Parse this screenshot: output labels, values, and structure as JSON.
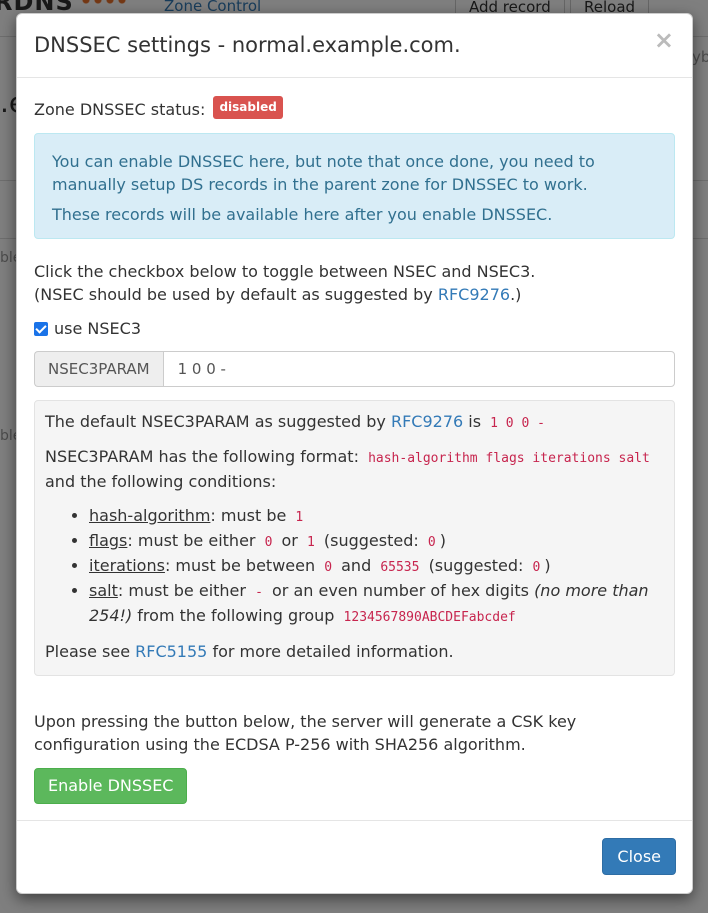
{
  "background": {
    "logo": "RDNS",
    "nav_link": "Zone Control",
    "add_record": "Add record",
    "reload": "Reload",
    "side_fragment": ".e",
    "right_fragment": "yb",
    "row1": "ble",
    "row2": "ble"
  },
  "modal": {
    "title": "DNSSEC settings - normal.example.com.",
    "close_x": "×",
    "status_label": "Zone DNSSEC status:",
    "status_badge": "disabled",
    "alert_line1": "You can enable DNSSEC here, but note that once done, you need to manually setup DS records in the parent zone for DNSSEC to work.",
    "alert_line2": "These records will be available here after you enable DNSSEC.",
    "desc_line1": "Click the checkbox below to toggle between NSEC and NSEC3.",
    "desc_line2_pre": "(NSEC should be used by default as suggested by ",
    "desc_line2_link": "RFC9276",
    "desc_line2_post": ".)",
    "checkbox_label": "use NSEC3",
    "checkbox_checked": true,
    "param_addon": "NSEC3PARAM",
    "param_value": "1 0 0 -",
    "well": {
      "default_pre": "The default NSEC3PARAM as suggested by",
      "default_link": "RFC9276",
      "default_is": "is",
      "default_code": "1 0 0 -",
      "format_pre": "NSEC3PARAM has the following format:",
      "format_code": "hash-algorithm flags iterations salt",
      "format_post": "and the following conditions:",
      "hash_term": "hash-algorithm",
      "hash_text": ": must be",
      "hash_code": "1",
      "flags_term": "flags",
      "flags_text": ": must be either",
      "flags_code1": "0",
      "flags_or": "or",
      "flags_code2": "1",
      "flags_sugg": "(suggested:",
      "flags_sugg_code": "0",
      "iter_term": "iterations",
      "iter_text": ": must be between",
      "iter_code1": "0",
      "iter_and": "and",
      "iter_code2": "65535",
      "iter_sugg": "(suggested:",
      "iter_sugg_code": "0",
      "salt_term": "salt",
      "salt_text": ": must be either",
      "salt_code": "-",
      "salt_mid": "or an even number of hex digits",
      "salt_em": "(no more than 254!)",
      "salt_post": "from the following group",
      "salt_group": "1234567890ABCDEFabcdef",
      "close_paren": ")",
      "see_pre": "Please see",
      "see_link": "RFC5155",
      "see_post": "for more detailed information."
    },
    "footer_text": "Upon pressing the button below, the server will generate a CSK key configuration using the ECDSA P-256 with SHA256 algorithm.",
    "enable_button": "Enable DNSSEC",
    "close_button": "Close"
  },
  "colors": {
    "badge_danger": "#d9534f",
    "alert_info_bg": "#d9edf7",
    "link": "#337ab7",
    "button_success": "#5cb85c",
    "button_primary": "#337ab7",
    "code": "#c7254e"
  }
}
